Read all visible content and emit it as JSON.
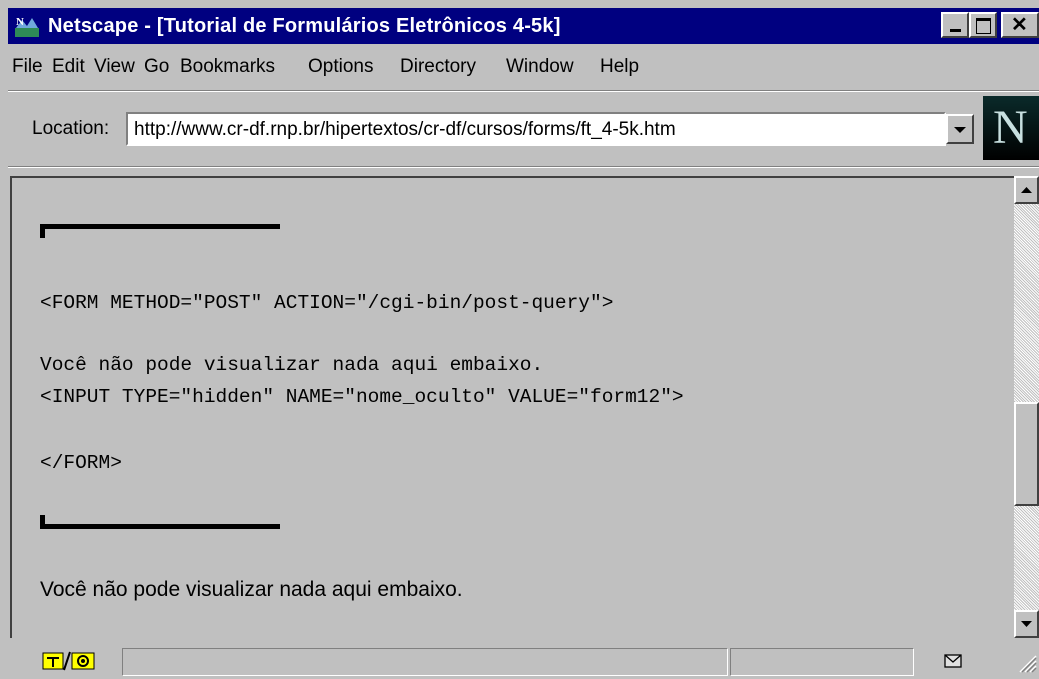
{
  "window": {
    "title": "Netscape - [Tutorial de Formulários Eletrônicos 4-5k]"
  },
  "menu": [
    "File",
    "Edit",
    "View",
    "Go",
    "Bookmarks",
    "Options",
    "Directory",
    "Window",
    "Help"
  ],
  "location": {
    "label": "Location:",
    "url": "http://www.cr-df.rnp.br/hipertextos/cr-df/cursos/forms/ft_4-5k.htm"
  },
  "logo": {
    "letter": "N"
  },
  "content": {
    "code_lines": [
      "<FORM METHOD=\"POST\" ACTION=\"/cgi-bin/post-query\">",
      "Você não pode visualizar nada aqui embaixo.",
      "<INPUT TYPE=\"hidden\" NAME=\"nome_oculto\" VALUE=\"form12\">",
      "</FORM>"
    ],
    "rendered_text": "Você não pode visualizar nada aqui embaixo."
  },
  "colors": {
    "titlebar": "#000080",
    "chrome": "#c0c0c0"
  }
}
